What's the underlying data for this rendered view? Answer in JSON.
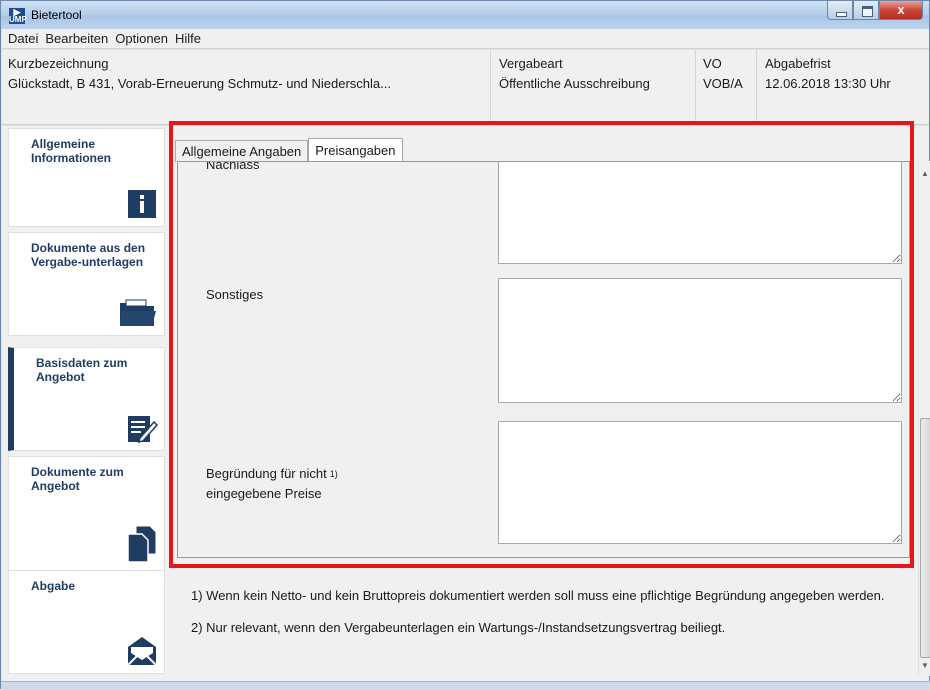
{
  "window": {
    "title": "Bietertool",
    "icon_text_top": "",
    "icon_text_bottom": "UMP",
    "close_glyph": "x"
  },
  "menu": [
    "Datei",
    "Bearbeiten",
    "Optionen",
    "Hilfe"
  ],
  "header": {
    "kurz_label": "Kurzbezeichnung",
    "kurz_value": "Glückstadt, B 431, Vorab-Erneuerung Schmutz- und Niederschla...",
    "vergabeart_label": "Vergabeart",
    "vergabeart_value": "Öffentliche Ausschreibung",
    "vo_label": "VO",
    "vo_value": "VOB/A",
    "frist_label": "Abgabefrist",
    "frist_value": "12.06.2018 13:30 Uhr"
  },
  "sidebar": {
    "items": [
      {
        "label": "Allgemeine Informationen",
        "icon": "info-icon"
      },
      {
        "label": "Dokumente aus den Vergabe-unterlagen",
        "icon": "folder-icon"
      },
      {
        "label": "Basisdaten zum Angebot",
        "icon": "edit-form-icon",
        "active": true
      },
      {
        "label": "Dokumente zum Angebot",
        "icon": "documents-icon"
      },
      {
        "label": "Abgabe",
        "icon": "envelope-icon"
      }
    ]
  },
  "tabs": [
    {
      "label": "Allgemeine Angaben",
      "selected": false
    },
    {
      "label": "Preisangaben",
      "selected": true
    }
  ],
  "fields": {
    "nachlass_label": "Nachlass",
    "sonstiges_label": "Sonstiges",
    "begruendung_label_1": "Begründung für nicht",
    "begruendung_sup": "1)",
    "begruendung_label_2": "eingegebene Preise",
    "nachlass_value": "",
    "sonstiges_value": "",
    "begruendung_value": ""
  },
  "notes": {
    "note1": "1) Wenn kein Netto- und kein Bruttopreis dokumentiert werden soll muss eine pflichtige Begründung angegeben werden.",
    "note2": "2) Nur relevant, wenn den Vergabeunterlagen ein Wartungs-/Instandsetzungsvertrag beiliegt."
  },
  "colors": {
    "highlight_frame": "#e8161b",
    "sidebar_text": "#1f3d63",
    "active_marker": "#1f3d63"
  }
}
